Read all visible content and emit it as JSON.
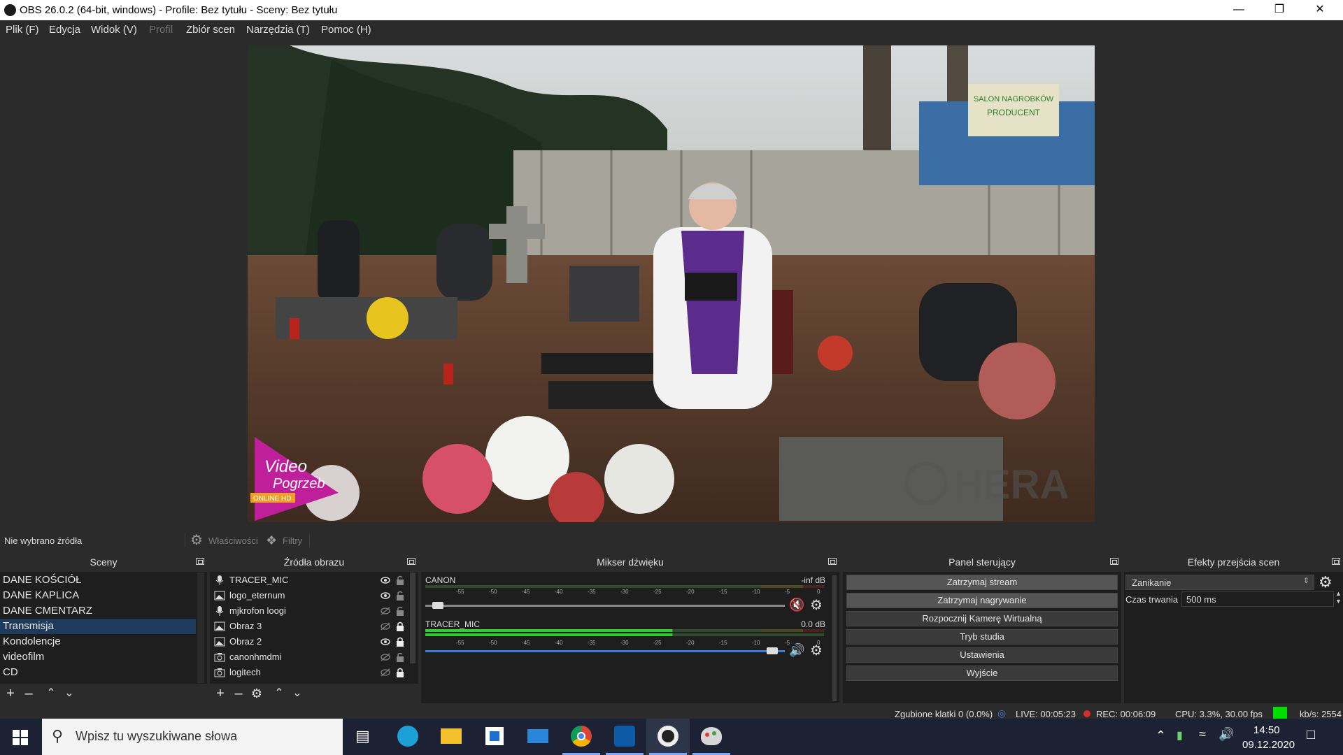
{
  "window": {
    "title": "OBS 26.0.2 (64-bit, windows) - Profile: Bez tytułu - Sceny: Bez tytułu",
    "controls": [
      "minimize-icon",
      "restore-icon",
      "close-icon"
    ]
  },
  "menu": [
    {
      "label": "Plik (F)",
      "enabled": true
    },
    {
      "label": "Edycja",
      "enabled": true
    },
    {
      "label": "Widok (V)",
      "enabled": true
    },
    {
      "label": "Profil",
      "enabled": false
    },
    {
      "label": "Zbiór scen",
      "enabled": true
    },
    {
      "label": "Narzędzia (T)",
      "enabled": true
    },
    {
      "label": "Pomoc (H)",
      "enabled": true
    }
  ],
  "preview": {
    "logo_left": {
      "line1": "Video",
      "line2": "Pogrzeb",
      "badge": "ONLINE HD"
    },
    "watermark": "HERA",
    "sign_text": {
      "line1": "SALON NAGROBKÓW",
      "line2": "PRODUCENT"
    }
  },
  "source_bar": {
    "status": "Nie wybrano źródła",
    "properties_label": "Właściwości",
    "filters_label": "Filtry"
  },
  "scenes": {
    "title": "Sceny",
    "items": [
      "DANE KOŚCIÓŁ",
      "DANE KAPLICA",
      "DANE CMENTARZ",
      "Transmisja",
      "Kondolencje",
      "videofilm",
      "CD"
    ],
    "selected_index": 3
  },
  "sources": {
    "title": "Źródła obrazu",
    "items": [
      {
        "name": "TRACER_MIC",
        "icon": "microphone-icon",
        "visible": true,
        "locked": false
      },
      {
        "name": "logo_eternum",
        "icon": "image-icon",
        "visible": true,
        "locked": false
      },
      {
        "name": "mjkrofon loogi",
        "icon": "microphone-icon",
        "visible": false,
        "locked": false
      },
      {
        "name": "Obraz 3",
        "icon": "image-icon",
        "visible": false,
        "locked": true
      },
      {
        "name": "Obraz 2",
        "icon": "image-icon",
        "visible": true,
        "locked": true
      },
      {
        "name": "canonhmdmi",
        "icon": "camera-icon",
        "visible": false,
        "locked": false
      },
      {
        "name": "logitech",
        "icon": "camera-icon",
        "visible": false,
        "locked": true
      }
    ]
  },
  "mixer": {
    "title": "Mikser dźwięku",
    "channels": [
      {
        "name": "CANON",
        "level": "-inf dB",
        "muted": true,
        "meter_level": 0.0,
        "volume": 0.02
      },
      {
        "name": "TRACER_MIC",
        "level": "0.0 dB",
        "muted": false,
        "meter_level": 0.62,
        "volume": 0.98
      }
    ],
    "scale": [
      "-60",
      "-55",
      "-50",
      "-45",
      "-40",
      "-35",
      "-30",
      "-25",
      "-20",
      "-15",
      "-10",
      "-5",
      "0"
    ]
  },
  "controls": {
    "title": "Panel sterujący",
    "buttons": [
      "Zatrzymaj stream",
      "Zatrzymaj nagrywanie",
      "Rozpocznij Kamerę Wirtualną",
      "Tryb studia",
      "Ustawienia",
      "Wyjście"
    ]
  },
  "transitions": {
    "title": "Efekty przejścia scen",
    "selected": "Zanikanie",
    "duration_label": "Czas trwania",
    "duration_value": "500 ms"
  },
  "status": {
    "dropped": "Zgubione klatki 0 (0.0%)",
    "live": "LIVE: 00:05:23",
    "rec": "REC: 00:06:09",
    "cpu": "CPU: 3.3%, 30.00 fps",
    "kbs": "kb/s: 2554"
  },
  "taskbar": {
    "search_placeholder": "Wpisz tu wyszukiwane słowa",
    "time": "14:50",
    "date": "09.12.2020",
    "apps": [
      "task-view-icon",
      "edge-icon",
      "file-explorer-icon",
      "store-icon",
      "mail-icon",
      "chrome-icon",
      "teamviewer-icon",
      "obs-icon",
      "paint-icon"
    ]
  },
  "colors": {
    "accent_selected": "#1f3b5c",
    "meter_green": "#33cc33",
    "meter_yellow": "#cccc33",
    "meter_red": "#cc3333",
    "mute_red": "#d83a3a",
    "status_green": "#00dd00"
  }
}
